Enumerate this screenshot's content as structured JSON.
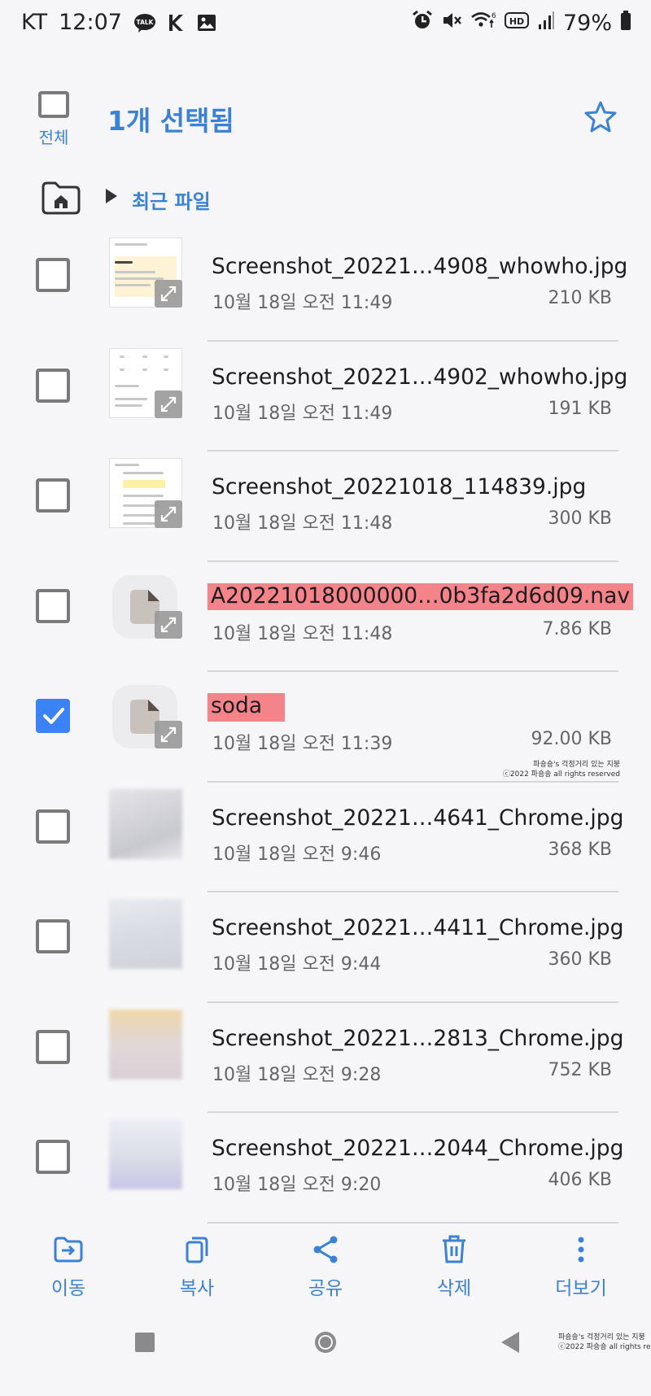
{
  "status_bar": {
    "carrier": "KT",
    "time": "12:07",
    "battery": "79%",
    "kakao_badge": "TALK",
    "network_label": "HD",
    "wifi_badge": "6"
  },
  "header": {
    "select_all_label": "전체",
    "selected_count_title": "1개 선택됨"
  },
  "breadcrumb": {
    "current": "최근 파일"
  },
  "files": [
    {
      "name": "Screenshot_20221…4908_whowho.jpg",
      "date": "10월 18일 오전 11:49",
      "size": "210 KB",
      "checked": false,
      "thumb": "screenshot"
    },
    {
      "name": "Screenshot_20221…4902_whowho.jpg",
      "date": "10월 18일 오전 11:49",
      "size": "191 KB",
      "checked": false,
      "thumb": "screenshot"
    },
    {
      "name": "Screenshot_20221018_114839.jpg",
      "date": "10월 18일 오전 11:48",
      "size": "300 KB",
      "checked": false,
      "thumb": "screenshot"
    },
    {
      "name": "A20221018000000…0b3fa2d6d09.nav",
      "date": "10월 18일 오전 11:48",
      "size": "7.86 KB",
      "checked": false,
      "thumb": "generic"
    },
    {
      "name": "soda",
      "date": "10월 18일 오전 11:39",
      "size": "92.00 KB",
      "checked": true,
      "thumb": "generic"
    },
    {
      "name": "Screenshot_20221…4641_Chrome.jpg",
      "date": "10월 18일 오전 9:46",
      "size": "368 KB",
      "checked": false,
      "thumb": "blurred"
    },
    {
      "name": "Screenshot_20221…4411_Chrome.jpg",
      "date": "10월 18일 오전 9:44",
      "size": "360 KB",
      "checked": false,
      "thumb": "blurred"
    },
    {
      "name": "Screenshot_20221…2813_Chrome.jpg",
      "date": "10월 18일 오전 9:28",
      "size": "752 KB",
      "checked": false,
      "thumb": "blurred"
    },
    {
      "name": "Screenshot_20221…2044_Chrome.jpg",
      "date": "10월 18일 오전 9:20",
      "size": "406 KB",
      "checked": false,
      "thumb": "blurred"
    }
  ],
  "watermark": {
    "line1": "파숑숑's 걱정거리 있는 지붕",
    "line2": "ⓒ2022 파숑숑 all rights reserved"
  },
  "actions": {
    "move": "이동",
    "copy": "복사",
    "share": "공유",
    "delete": "삭제",
    "more": "더보기"
  },
  "colors": {
    "accent": "#3b82d6",
    "highlight": "#f4838a",
    "background": "#f6f6f8"
  }
}
